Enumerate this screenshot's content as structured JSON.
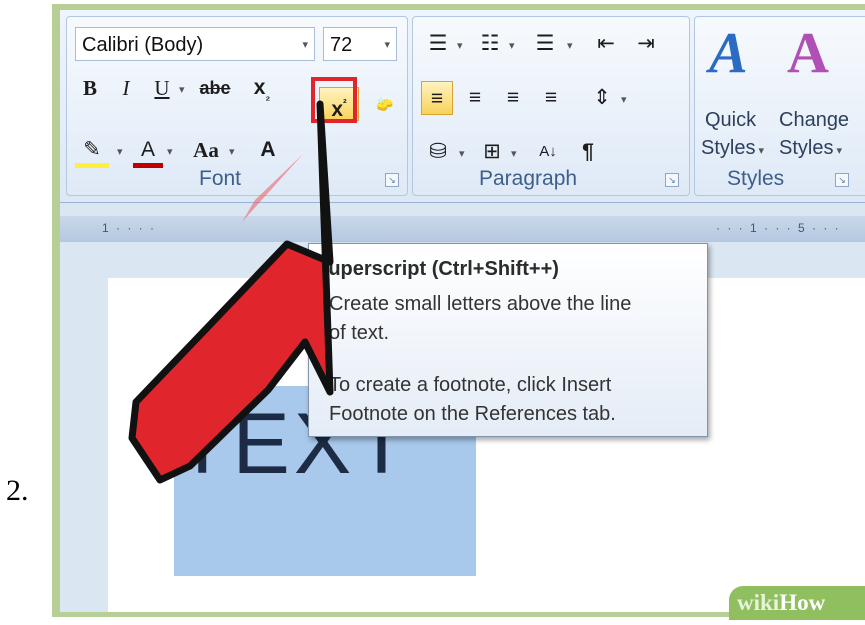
{
  "step": {
    "number": "2."
  },
  "ribbon": {
    "font_group": {
      "label": "Font",
      "font_name": "Calibri (Body)",
      "font_size": "72",
      "bold": "B",
      "italic": "I",
      "underline": "U",
      "strikethrough": "abe",
      "subscript": "x",
      "superscript": "x",
      "text_effects": "Aa",
      "font_color": "A",
      "grow_font": "A"
    },
    "paragraph_group": {
      "label": "Paragraph",
      "pilcrow": "¶",
      "sort": "A↓"
    },
    "styles_group": {
      "label": "Styles",
      "quick_styles_line1": "Quick",
      "quick_styles_line2": "Styles",
      "change_styles_line1": "Change",
      "change_styles_line2": "Styles"
    }
  },
  "ruler": {
    "left_mark": "1 · · · ·",
    "right_mark": "· · · 1 · · · 5 · · ·"
  },
  "document": {
    "text": "TEXT"
  },
  "tooltip": {
    "title": "Superscript (Ctrl+Shift++)",
    "line1": "Create small letters above the line",
    "line2": "of text.",
    "line3": "To create a footnote, click Insert",
    "line4": "Footnote on the References tab."
  },
  "watermark": {
    "part1": "wiki",
    "part2": "How"
  },
  "colors": {
    "arrow": "#e0262c",
    "highlight": "#a8c9ec",
    "frame": "#b7cf96"
  }
}
